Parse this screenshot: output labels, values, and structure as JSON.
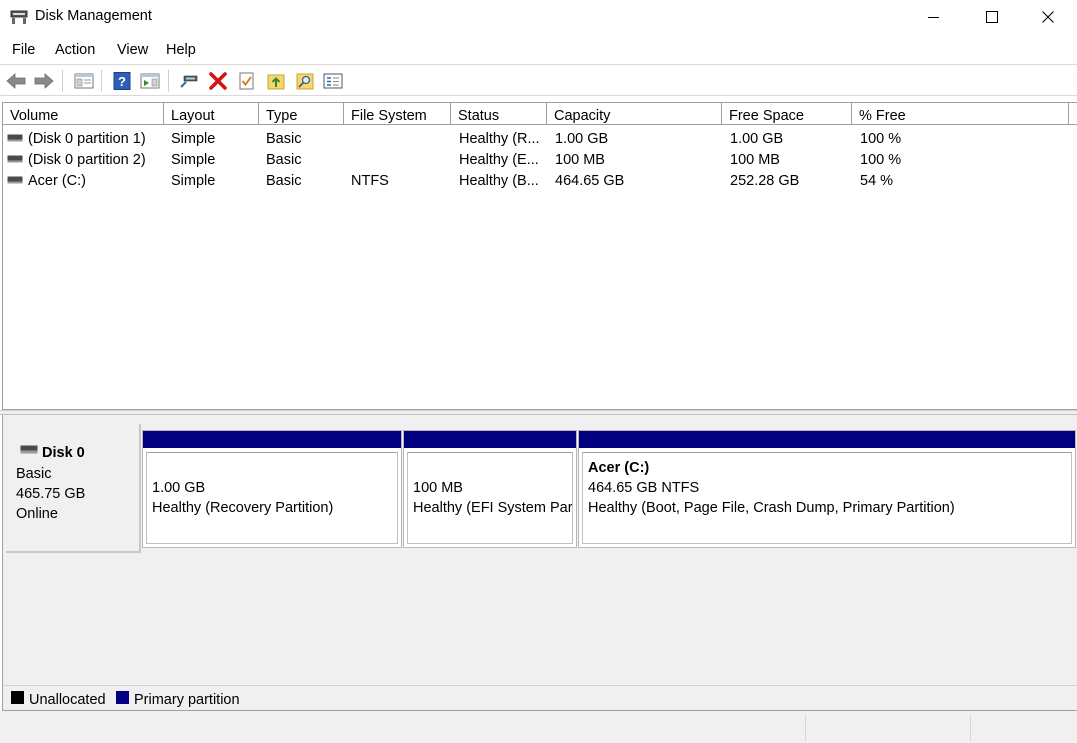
{
  "window": {
    "title": "Disk Management",
    "app_icon": "disk-management-icon",
    "controls": [
      "minimize-icon",
      "maximize-icon",
      "close-icon"
    ]
  },
  "menu": {
    "items": [
      "File",
      "Action",
      "View",
      "Help"
    ]
  },
  "toolbar": {
    "buttons": [
      "back-arrow-icon",
      "forward-arrow-icon",
      "show-hide-console-tree-icon",
      "help-icon",
      "show-action-pane-icon",
      "connect-virtual-disk-icon",
      "delete-icon",
      "properties-check-icon",
      "open-folder-up-icon",
      "find-icon",
      "list-view-icon"
    ]
  },
  "volume_list": {
    "columns": [
      "Volume",
      "Layout",
      "Type",
      "File System",
      "Status",
      "Capacity",
      "Free Space",
      "% Free"
    ],
    "rows": [
      {
        "volume": "(Disk 0 partition 1)",
        "layout": "Simple",
        "type": "Basic",
        "fs": "",
        "status": "Healthy (R...",
        "capacity": "1.00 GB",
        "free": "1.00 GB",
        "pct": "100 %"
      },
      {
        "volume": "(Disk 0 partition 2)",
        "layout": "Simple",
        "type": "Basic",
        "fs": "",
        "status": "Healthy (E...",
        "capacity": "100 MB",
        "free": "100 MB",
        "pct": "100 %"
      },
      {
        "volume": "Acer (C:)",
        "layout": "Simple",
        "type": "Basic",
        "fs": "NTFS",
        "status": "Healthy (B...",
        "capacity": "464.65 GB",
        "free": "252.28 GB",
        "pct": "54 %"
      }
    ]
  },
  "disk": {
    "name": "Disk 0",
    "type": "Basic",
    "size": "465.75 GB",
    "state": "Online",
    "partitions": [
      {
        "title": "",
        "size": "1.00 GB",
        "status": "Healthy (Recovery Partition)"
      },
      {
        "title": "",
        "size": "100 MB",
        "status": "Healthy (EFI System Partition)"
      },
      {
        "title": "Acer  (C:)",
        "size": "464.65 GB NTFS",
        "status": "Healthy (Boot, Page File, Crash Dump, Primary Partition)"
      }
    ]
  },
  "legend": {
    "unallocated": "Unallocated",
    "primary": "Primary partition",
    "unallocated_color": "#000000",
    "primary_color": "#000080"
  }
}
